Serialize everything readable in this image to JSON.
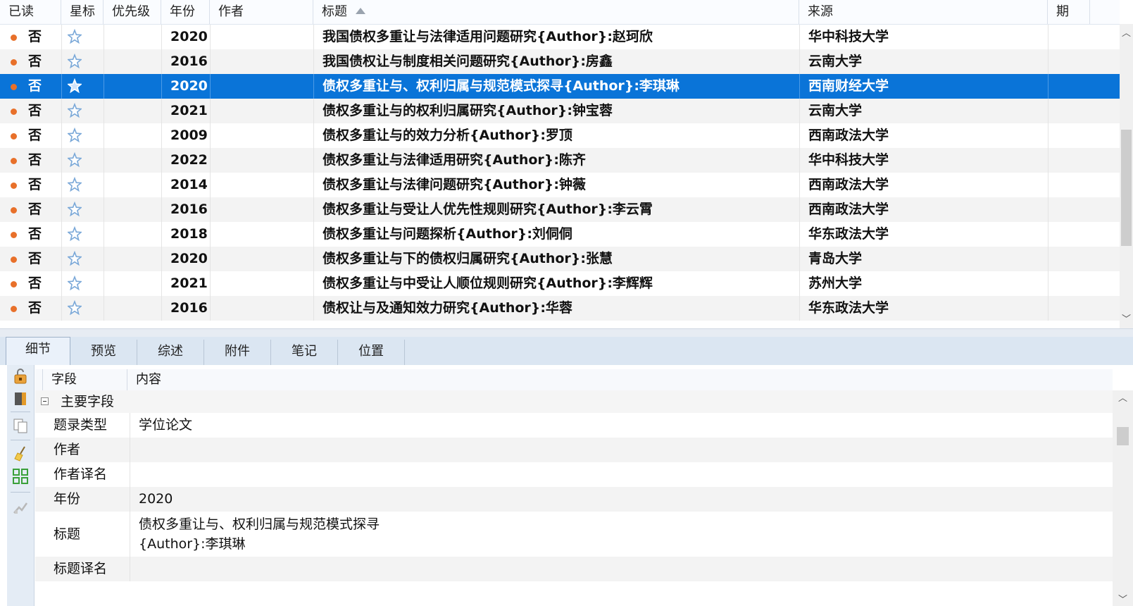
{
  "list": {
    "columns": [
      {
        "key": "read",
        "label": "已读"
      },
      {
        "key": "star",
        "label": "星标"
      },
      {
        "key": "priority",
        "label": "优先级"
      },
      {
        "key": "year",
        "label": "年份"
      },
      {
        "key": "author",
        "label": "作者"
      },
      {
        "key": "title",
        "label": "标题"
      },
      {
        "key": "source",
        "label": "来源"
      },
      {
        "key": "issue",
        "label": "期"
      }
    ],
    "rows": [
      {
        "read": "否",
        "year": "2020",
        "title": "我国债权多重让与法律适用问题研究{Author}:赵珂欣",
        "source": "华中科技大学"
      },
      {
        "read": "否",
        "year": "2016",
        "title": "我国债权让与制度相关问题研究{Author}:房鑫",
        "source": "云南大学"
      },
      {
        "read": "否",
        "year": "2020",
        "title": "债权多重让与、权利归属与规范模式探寻{Author}:李琪琳",
        "source": "西南财经大学",
        "selected": true
      },
      {
        "read": "否",
        "year": "2021",
        "title": "债权多重让与的权利归属研究{Author}:钟宝蓉",
        "source": "云南大学"
      },
      {
        "read": "否",
        "year": "2009",
        "title": "债权多重让与的效力分析{Author}:罗顶",
        "source": "西南政法大学"
      },
      {
        "read": "否",
        "year": "2022",
        "title": "债权多重让与法律适用研究{Author}:陈齐",
        "source": "华中科技大学"
      },
      {
        "read": "否",
        "year": "2014",
        "title": "债权多重让与法律问题研究{Author}:钟薇",
        "source": "西南政法大学"
      },
      {
        "read": "否",
        "year": "2016",
        "title": "债权多重让与受让人优先性规则研究{Author}:李云霄",
        "source": "西南政法大学"
      },
      {
        "read": "否",
        "year": "2018",
        "title": "债权多重让与问题探析{Author}:刘侗侗",
        "source": "华东政法大学"
      },
      {
        "read": "否",
        "year": "2020",
        "title": "债权多重让与下的债权归属研究{Author}:张慧",
        "source": "青岛大学"
      },
      {
        "read": "否",
        "year": "2021",
        "title": "债权多重让与中受让人顺位规则研究{Author}:李辉辉",
        "source": "苏州大学"
      },
      {
        "read": "否",
        "year": "2016",
        "title": "债权让与及通知效力研究{Author}:华蓉",
        "source": "华东政法大学"
      }
    ]
  },
  "tabs": [
    "细节",
    "预览",
    "综述",
    "附件",
    "笔记",
    "位置"
  ],
  "detail": {
    "headers": {
      "field": "字段",
      "content": "内容"
    },
    "group_label": "主要字段",
    "fields": [
      {
        "name": "题录类型",
        "value": "学位论文"
      },
      {
        "name": "作者",
        "value": ""
      },
      {
        "name": "作者译名",
        "value": ""
      },
      {
        "name": "年份",
        "value": "2020"
      },
      {
        "name": "标题",
        "value": "债权多重让与、权利归属与规范模式探寻",
        "value2": "{Author}:李琪琳"
      },
      {
        "name": "标题译名",
        "value": ""
      }
    ]
  },
  "colors": {
    "selection": "#0a74d8",
    "unread_dot": "#e8702a",
    "star": "#7aa8d8"
  },
  "icons": {
    "scroll_up": "︿",
    "scroll_down": "﹀"
  }
}
